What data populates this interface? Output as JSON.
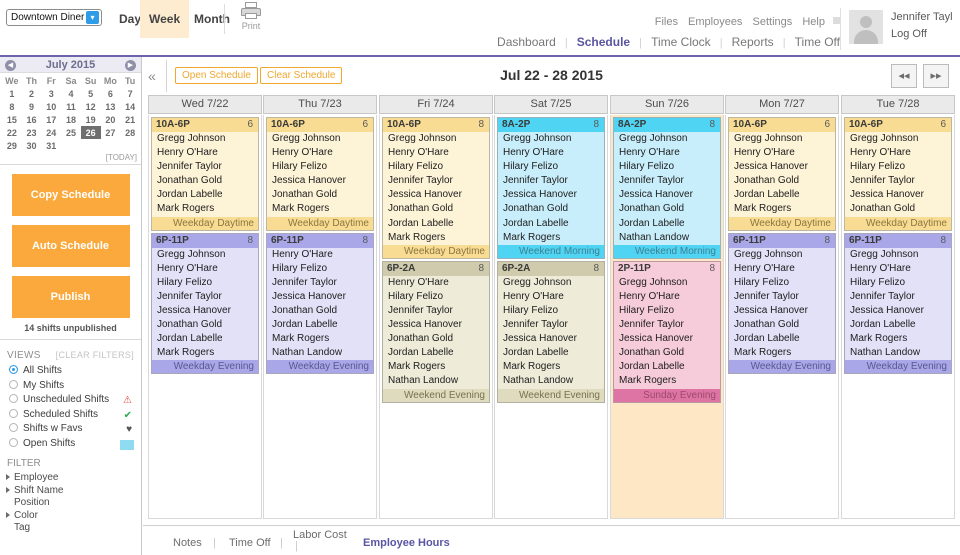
{
  "topbar": {
    "business": "Downtown Diner",
    "caret_icon": "chevron-updown-icon",
    "view_tabs": [
      {
        "id": "day",
        "label": "Day",
        "active": false
      },
      {
        "id": "week",
        "label": "Week",
        "active": true
      },
      {
        "id": "month",
        "label": "Month",
        "active": false
      }
    ],
    "print_label": "Print",
    "util_links": [
      "Files",
      "Employees",
      "Settings",
      "Help"
    ],
    "main_nav": [
      {
        "label": "Dashboard",
        "active": false
      },
      {
        "label": "Schedule",
        "active": true
      },
      {
        "label": "Time Clock",
        "active": false
      },
      {
        "label": "Reports",
        "active": false
      },
      {
        "label": "Time Off",
        "active": false
      }
    ],
    "nav_separator": "|",
    "user_name": "Jennifer Tayl",
    "log_off": "Log Off"
  },
  "sidebar": {
    "calendar": {
      "title": "July 2015",
      "prev_icon": "chevron-left-icon",
      "next_icon": "chevron-right-icon",
      "weekdays": [
        "We",
        "Th",
        "Fr",
        "Sa",
        "Su",
        "Mo",
        "Tu"
      ],
      "weeks": [
        [
          "1",
          "2",
          "3",
          "4",
          "5",
          "6",
          "7"
        ],
        [
          "8",
          "9",
          "10",
          "11",
          "12",
          "13",
          "14"
        ],
        [
          "15",
          "16",
          "17",
          "18",
          "19",
          "20",
          "21"
        ],
        [
          "22",
          "23",
          "24",
          "25",
          "26",
          "27",
          "28"
        ],
        [
          "29",
          "30",
          "31",
          "",
          "",
          "",
          ""
        ]
      ],
      "selected_day": "26",
      "today_label": "[TODAY]"
    },
    "actions": [
      {
        "id": "copy-schedule",
        "label": "Copy Schedule"
      },
      {
        "id": "auto-schedule",
        "label": "Auto Schedule"
      },
      {
        "id": "publish",
        "label": "Publish"
      }
    ],
    "unpublished_note": "14 shifts unpublished",
    "views_header": "VIEWS",
    "clear_filters": "[CLEAR FILTERS]",
    "views": [
      {
        "label": "All Shifts",
        "selected": true,
        "mark": "",
        "mark_icon": ""
      },
      {
        "label": "My Shifts",
        "selected": false,
        "mark": "",
        "mark_icon": ""
      },
      {
        "label": "Unscheduled Shifts",
        "selected": false,
        "mark": "⚠",
        "mark_icon": "warning-triangle-icon",
        "mark_color": "#e8453c"
      },
      {
        "label": "Scheduled Shifts",
        "selected": false,
        "mark": "✔",
        "mark_icon": "check-circle-icon",
        "mark_color": "#2faa55"
      },
      {
        "label": "Shifts w Favs",
        "selected": false,
        "mark": "♥",
        "mark_icon": "heart-icon",
        "mark_color": "#555555"
      },
      {
        "label": "Open Shifts",
        "selected": false,
        "mark": "",
        "mark_icon": "blue-swatch-icon",
        "mark_color": "#8fdcf2"
      }
    ],
    "filter_header": "FILTER",
    "filters": [
      {
        "label": "Employee",
        "expandable": true
      },
      {
        "label": "Shift Name",
        "expandable": true
      },
      {
        "label": "Position",
        "expandable": false
      },
      {
        "label": "Color",
        "expandable": true
      },
      {
        "label": "Tag",
        "expandable": false
      }
    ]
  },
  "schedule": {
    "collapse_icon": "double-chevron-left-icon",
    "open_schedule": "Open Schedule",
    "clear_schedule": "Clear Schedule",
    "date_range": "Jul 22 - 28 2015",
    "prev_icon": "double-arrow-left-icon",
    "next_icon": "double-arrow-right-icon",
    "days": [
      {
        "header": "Wed 7/22",
        "highlight": false,
        "shifts": [
          {
            "time": "10A-6P",
            "count": "6",
            "footer": "Weekday Daytime",
            "head_bg": "#f8dc93",
            "body_bg": "#fdf3d7",
            "foot_bg": "#f8dc93",
            "foot_color": "#8a7640",
            "employees": [
              "Gregg Johnson",
              "Henry O'Hare",
              "Jennifer Taylor",
              "Jonathan Gold",
              "Jordan Labelle",
              "Mark Rogers"
            ]
          },
          {
            "time": "6P-11P",
            "count": "8",
            "footer": "Weekday Evening",
            "head_bg": "#aaa7e8",
            "body_bg": "#e2e1f8",
            "foot_bg": "#aaa7e8",
            "foot_color": "#5a578f",
            "employees": [
              "Gregg Johnson",
              "Henry O'Hare",
              "Hilary Felizo",
              "Jennifer Taylor",
              "Jessica Hanover",
              "Jonathan Gold",
              "Jordan Labelle",
              "Mark Rogers"
            ]
          }
        ]
      },
      {
        "header": "Thu 7/23",
        "highlight": false,
        "shifts": [
          {
            "time": "10A-6P",
            "count": "6",
            "footer": "Weekday Daytime",
            "head_bg": "#f8dc93",
            "body_bg": "#fdf3d7",
            "foot_bg": "#f8dc93",
            "foot_color": "#8a7640",
            "employees": [
              "Gregg Johnson",
              "Henry O'Hare",
              "Hilary Felizo",
              "Jessica Hanover",
              "Jonathan Gold",
              "Mark Rogers"
            ]
          },
          {
            "time": "6P-11P",
            "count": "8",
            "footer": "Weekday Evening",
            "head_bg": "#aaa7e8",
            "body_bg": "#e2e1f8",
            "foot_bg": "#aaa7e8",
            "foot_color": "#5a578f",
            "employees": [
              "Henry O'Hare",
              "Hilary Felizo",
              "Jennifer Taylor",
              "Jessica Hanover",
              "Jonathan Gold",
              "Jordan Labelle",
              "Mark Rogers",
              "Nathan Landow"
            ]
          }
        ]
      },
      {
        "header": "Fri 7/24",
        "highlight": false,
        "shifts": [
          {
            "time": "10A-6P",
            "count": "8",
            "footer": "Weekday Daytime",
            "head_bg": "#f8dc93",
            "body_bg": "#fdf3d7",
            "foot_bg": "#f8dc93",
            "foot_color": "#8a7640",
            "employees": [
              "Gregg Johnson",
              "Henry O'Hare",
              "Hilary Felizo",
              "Jennifer Taylor",
              "Jessica Hanover",
              "Jonathan Gold",
              "Jordan Labelle",
              "Mark Rogers"
            ]
          },
          {
            "time": "6P-2A",
            "count": "8",
            "footer": "Weekend Evening",
            "head_bg": "#cfcbac",
            "body_bg": "#eeebd8",
            "foot_bg": "#dedbbe",
            "foot_color": "#77724e",
            "employees": [
              "Henry O'Hare",
              "Hilary Felizo",
              "Jennifer Taylor",
              "Jessica Hanover",
              "Jonathan Gold",
              "Jordan Labelle",
              "Mark Rogers",
              "Nathan Landow"
            ]
          }
        ]
      },
      {
        "header": "Sat 7/25",
        "highlight": false,
        "shifts": [
          {
            "time": "8A-2P",
            "count": "8",
            "footer": "Weekend Morning",
            "head_bg": "#4fd5f3",
            "body_bg": "#c8eefb",
            "foot_bg": "#4fd5f3",
            "foot_color": "#3f7f92",
            "employees": [
              "Gregg Johnson",
              "Henry O'Hare",
              "Hilary Felizo",
              "Jennifer Taylor",
              "Jessica Hanover",
              "Jonathan Gold",
              "Jordan Labelle",
              "Mark Rogers"
            ]
          },
          {
            "time": "6P-2A",
            "count": "8",
            "footer": "Weekend Evening",
            "head_bg": "#cfcbac",
            "body_bg": "#eeebd8",
            "foot_bg": "#dedbbe",
            "foot_color": "#77724e",
            "employees": [
              "Gregg Johnson",
              "Henry O'Hare",
              "Hilary Felizo",
              "Jennifer Taylor",
              "Jessica Hanover",
              "Jordan Labelle",
              "Mark Rogers",
              "Nathan Landow"
            ]
          }
        ]
      },
      {
        "header": "Sun 7/26",
        "highlight": true,
        "shifts": [
          {
            "time": "8A-2P",
            "count": "8",
            "footer": "Weekend Morning",
            "head_bg": "#4fd5f3",
            "body_bg": "#c8eefb",
            "foot_bg": "#4fd5f3",
            "foot_color": "#3f7f92",
            "employees": [
              "Gregg Johnson",
              "Henry O'Hare",
              "Hilary Felizo",
              "Jennifer Taylor",
              "Jessica Hanover",
              "Jonathan Gold",
              "Jordan Labelle",
              "Nathan Landow"
            ]
          },
          {
            "time": "2P-11P",
            "count": "8",
            "footer": "Sunday Evening",
            "head_bg": "#e островa",
            "body_bg": "#f7ccda",
            "foot_bg": "#de74a3",
            "foot_color": "#9c4a6c",
            "employees": [
              "Gregg Johnson",
              "Henry O'Hare",
              "Hilary Felizo",
              "Jennifer Taylor",
              "Jessica Hanover",
              "Jonathan Gold",
              "Jordan Labelle",
              "Mark Rogers"
            ]
          }
        ]
      },
      {
        "header": "Mon 7/27",
        "highlight": false,
        "shifts": [
          {
            "time": "10A-6P",
            "count": "6",
            "footer": "Weekday Daytime",
            "head_bg": "#f8dc93",
            "body_bg": "#fdf3d7",
            "foot_bg": "#f8dc93",
            "foot_color": "#8a7640",
            "employees": [
              "Gregg Johnson",
              "Henry O'Hare",
              "Jessica Hanover",
              "Jonathan Gold",
              "Jordan Labelle",
              "Mark Rogers"
            ]
          },
          {
            "time": "6P-11P",
            "count": "8",
            "footer": "Weekday Evening",
            "head_bg": "#aaa7e8",
            "body_bg": "#e2e1f8",
            "foot_bg": "#aaa7e8",
            "foot_color": "#5a578f",
            "employees": [
              "Gregg Johnson",
              "Henry O'Hare",
              "Hilary Felizo",
              "Jennifer Taylor",
              "Jessica Hanover",
              "Jonathan Gold",
              "Jordan Labelle",
              "Mark Rogers"
            ]
          }
        ]
      },
      {
        "header": "Tue 7/28",
        "highlight": false,
        "shifts": [
          {
            "time": "10A-6P",
            "count": "6",
            "footer": "Weekday Daytime",
            "head_bg": "#f8dc93",
            "body_bg": "#fdf3d7",
            "foot_bg": "#f8dc93",
            "foot_color": "#8a7640",
            "employees": [
              "Gregg Johnson",
              "Henry O'Hare",
              "Hilary Felizo",
              "Jennifer Taylor",
              "Jessica Hanover",
              "Jonathan Gold"
            ]
          },
          {
            "time": "6P-11P",
            "count": "8",
            "footer": "Weekday Evening",
            "head_bg": "#aaa7e8",
            "body_bg": "#e2e1f8",
            "foot_bg": "#aaa7e8",
            "foot_color": "#5a578f",
            "employees": [
              "Gregg Johnson",
              "Henry O'Hare",
              "Hilary Felizo",
              "Jennifer Taylor",
              "Jessica Hanover",
              "Jordan Labelle",
              "Mark Rogers",
              "Nathan Landow"
            ]
          }
        ]
      }
    ]
  },
  "bottom_tabs": [
    {
      "label": "Notes",
      "active": false
    },
    {
      "label": "Time Off",
      "active": false
    },
    {
      "label": "Labor Cost",
      "active": false
    },
    {
      "label": "Employee Hours",
      "active": true
    }
  ],
  "colors": {
    "accent_purple": "#5a55a3",
    "accent_orange": "#fba93c",
    "rule_purple": "#6b63ab"
  }
}
